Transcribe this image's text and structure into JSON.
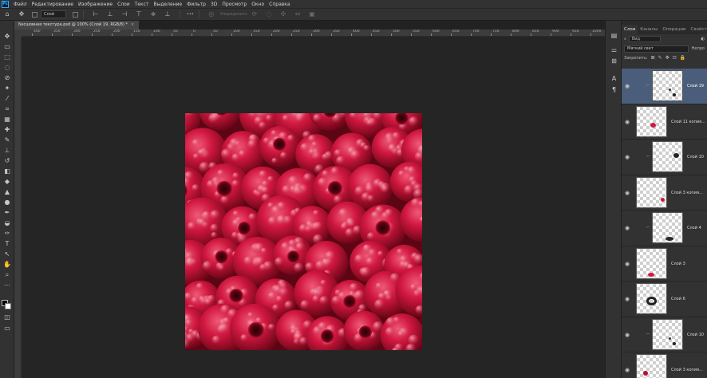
{
  "menubar": {
    "logo": "Ps",
    "items": [
      "Файл",
      "Редактирование",
      "Изображение",
      "Слои",
      "Текст",
      "Выделение",
      "Фильтр",
      "3D",
      "Просмотр",
      "Окно",
      "Справка"
    ]
  },
  "options": {
    "auto_select_value": "Слой",
    "more_label": "•••",
    "disabled_label": "Упорядочить"
  },
  "tab": {
    "title": "Бесшовная текстура.psd @ 100% (Слой 19, RGB/8) *",
    "close": "×"
  },
  "ruler": {
    "labels": [
      "400",
      "350",
      "300",
      "250",
      "200",
      "150",
      "100",
      "50",
      "0",
      "50",
      "100",
      "150",
      "200",
      "250",
      "300",
      "350",
      "400",
      "450",
      "500",
      "550",
      "600",
      "650",
      "700",
      "750",
      "800",
      "850",
      "900",
      "950",
      "1000"
    ]
  },
  "panels": {
    "tabs": [
      "Слои",
      "Каналы",
      "Операции",
      "Свойства"
    ],
    "filter_label": "Вид",
    "blend_mode": "Мягкий свет",
    "opacity_label": "Непро",
    "lock_label": "Закрепить:"
  },
  "layers": [
    {
      "name": "Слой 19",
      "selected": true,
      "offset": true,
      "mark": "dots"
    },
    {
      "name": "Слой 11 копия...",
      "selected": false,
      "offset": false,
      "mark": "red"
    },
    {
      "name": "Слой 10",
      "selected": false,
      "offset": true,
      "mark": "blob"
    },
    {
      "name": "Слой 3 копия...",
      "selected": false,
      "offset": false,
      "mark": "red-small"
    },
    {
      "name": "Слой 4",
      "selected": false,
      "offset": true,
      "mark": "smudge"
    },
    {
      "name": "Слой 3",
      "selected": false,
      "offset": false,
      "mark": "red-low"
    },
    {
      "name": "Слой 6",
      "selected": false,
      "offset": false,
      "mark": "ring"
    },
    {
      "name": "Слой 10",
      "selected": false,
      "offset": true,
      "mark": "dots"
    },
    {
      "name": "Слой 3 копия...",
      "selected": false,
      "offset": false,
      "mark": "red-bottom"
    }
  ],
  "colors": {
    "accent_selected": "#4a5d7a",
    "raspberry": "#c8173d"
  }
}
